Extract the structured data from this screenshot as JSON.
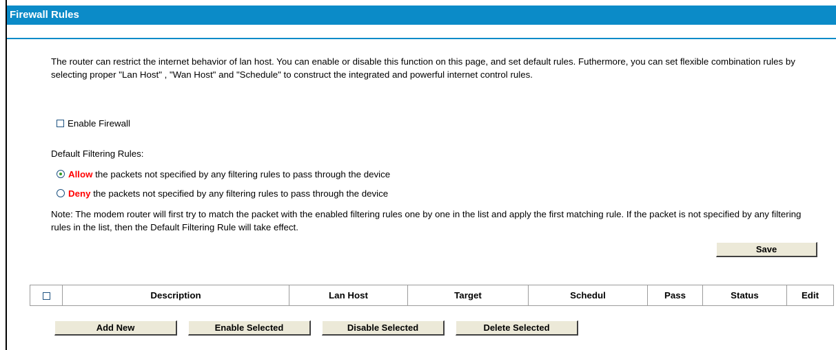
{
  "header": {
    "title": "Firewall Rules"
  },
  "intro": {
    "text": "The router can restrict the internet behavior of lan host. You can enable or disable this function on this page, and set default rules. Futhermore, you can set flexible combination rules by selecting proper \"Lan Host\" , \"Wan Host\" and \"Schedule\" to construct the integrated and powerful internet control rules."
  },
  "firewall": {
    "enable_label": "Enable Firewall",
    "enabled": false
  },
  "default_rules": {
    "label": "Default Filtering Rules:",
    "allow_keyword": "Allow",
    "allow_text": " the packets not specified by any filtering rules to pass through the device",
    "deny_keyword": "Deny",
    "deny_text": " the packets not specified by any filtering rules to pass through the device",
    "selected": "Allow"
  },
  "note": {
    "text": "Note: The modem router will first try to match the packet with the enabled filtering rules one by one in the list and apply the first matching rule. If the packet is not specified by any filtering rules in the list, then the Default Filtering Rule will take effect."
  },
  "actions": {
    "save_label": "Save",
    "add_new_label": "Add New",
    "enable_selected_label": "Enable Selected",
    "disable_selected_label": "Disable Selected",
    "delete_selected_label": "Delete Selected"
  },
  "table": {
    "columns": [
      "Description",
      "Lan Host",
      "Target",
      "Schedul",
      "Pass",
      "Status",
      "Edit"
    ],
    "rows": []
  },
  "colors": {
    "header_bg": "#0b8bc8",
    "keyword": "#ff0000",
    "radio_dot": "#2f9a1e",
    "button_bg": "#ece9d8"
  }
}
